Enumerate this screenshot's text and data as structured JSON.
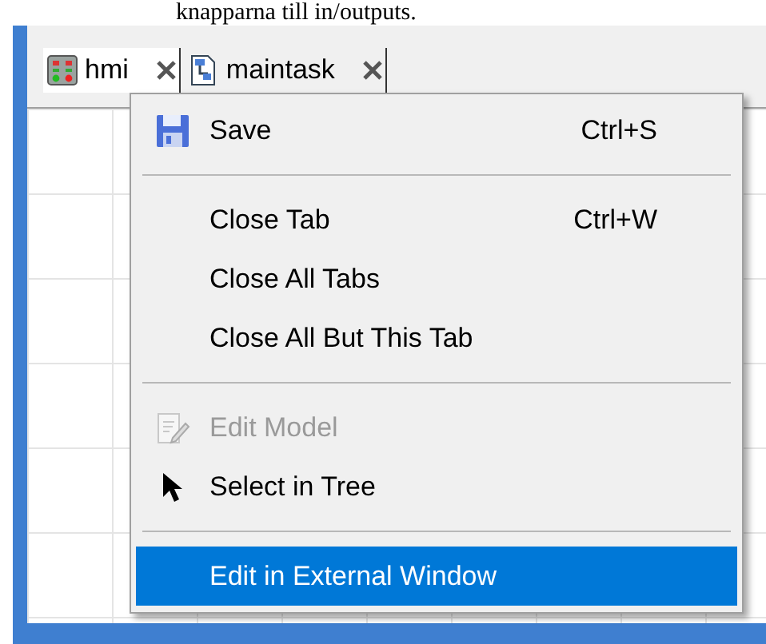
{
  "caption": "knapparna till in/outputs.",
  "tabs": [
    {
      "label": "hmi",
      "kind": "hmi",
      "selected": true
    },
    {
      "label": "maintask",
      "kind": "task",
      "selected": false
    }
  ],
  "context_menu": {
    "items": [
      {
        "kind": "save",
        "label": "Save",
        "shortcut": "Ctrl+S",
        "disabled": false,
        "selected": false
      },
      {
        "kind": "separator"
      },
      {
        "kind": "item",
        "label": "Close Tab",
        "shortcut": "Ctrl+W",
        "disabled": false,
        "selected": false
      },
      {
        "kind": "item",
        "label": "Close All Tabs",
        "disabled": false,
        "selected": false
      },
      {
        "kind": "item",
        "label": "Close All But This Tab",
        "disabled": false,
        "selected": false
      },
      {
        "kind": "separator"
      },
      {
        "kind": "edit",
        "label": "Edit Model",
        "disabled": true,
        "selected": false
      },
      {
        "kind": "select",
        "label": "Select in Tree",
        "disabled": false,
        "selected": false
      },
      {
        "kind": "separator"
      },
      {
        "kind": "item",
        "label": "Edit in External Window",
        "disabled": false,
        "selected": true
      }
    ]
  }
}
